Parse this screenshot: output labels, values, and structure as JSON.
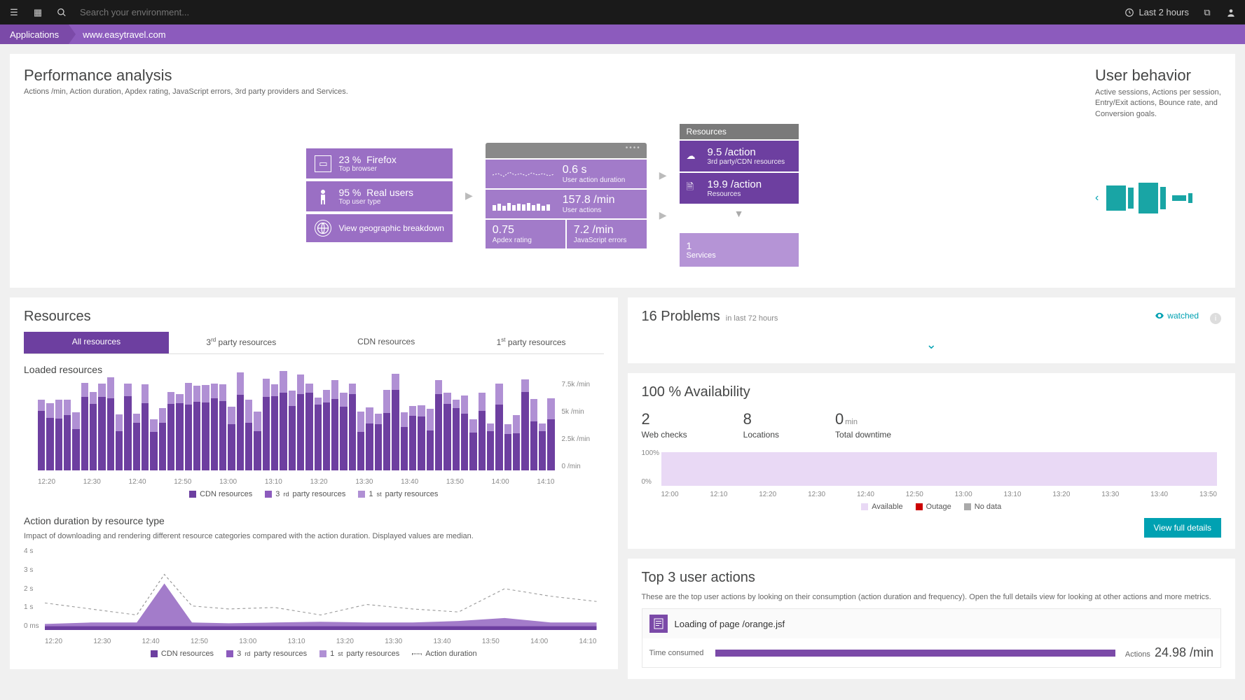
{
  "topbar": {
    "search_placeholder": "Search your environment...",
    "timerange": "Last 2 hours"
  },
  "breadcrumb": {
    "item1": "Applications",
    "item2": "www.easytravel.com"
  },
  "perf": {
    "title": "Performance analysis",
    "subtitle": "Actions /min, Action duration, Apdex rating, JavaScript errors, 3rd party providers and Services.",
    "browser_pct": "23 %",
    "browser_name": "Firefox",
    "browser_sub": "Top browser",
    "users_pct": "95 %",
    "users_name": "Real users",
    "users_sub": "Top user type",
    "geo": "View geographic breakdown",
    "duration": "0.6 s",
    "duration_sub": "User action duration",
    "actions_min": "157.8 /min",
    "actions_sub": "User actions",
    "apdex": "0.75",
    "apdex_sub": "Apdex rating",
    "jserr": "7.2 /min",
    "jserr_sub": "JavaScript errors",
    "resources_head": "Resources",
    "res1": "9.5 /action",
    "res1_sub": "3rd party/CDN resources",
    "res2": "19.9 /action",
    "res2_sub": "Resources",
    "svc_n": "1",
    "svc_sub": "Services"
  },
  "userbeh": {
    "title": "User behavior",
    "subtitle": "Active sessions, Actions per session, Entry/Exit actions, Bounce rate, and Conversion goals."
  },
  "resources": {
    "title": "Resources",
    "tabs": {
      "all": "All resources",
      "third": "3rd party resources",
      "cdn": "CDN resources",
      "first": "1st party resources"
    },
    "loaded": "Loaded resources",
    "legend_cdn": "CDN resources",
    "legend_third": "3rd party resources",
    "legend_first": "1st party resources",
    "action_title": "Action duration by resource type",
    "action_desc": "Impact of downloading and rendering different resource categories compared with the action duration. Displayed values are median.",
    "legend_action": "Action duration"
  },
  "problems": {
    "title": "16 Problems",
    "in": "in last 72 hours",
    "watched": "watched"
  },
  "avail": {
    "title": "100 % Availability",
    "webchecks_n": "2",
    "webchecks_l": "Web checks",
    "locations_n": "8",
    "locations_l": "Locations",
    "downtime_n": "0",
    "downtime_u": "min",
    "downtime_l": "Total downtime",
    "leg_available": "Available",
    "leg_outage": "Outage",
    "leg_nodata": "No data",
    "btn": "View full details"
  },
  "topactions": {
    "title": "Top 3 user actions",
    "desc": "These are the top user actions by looking on their consumption (action duration and frequency). Open the full details view for looking at other actions and more metrics.",
    "a1_name": "Loading of page /orange.jsf",
    "a1_time_lbl": "Time consumed",
    "a1_actions_lbl": "Actions",
    "a1_actions_v": "24.98 /min"
  },
  "chart_data": [
    {
      "type": "bar",
      "title": "Loaded resources",
      "ylabel": "/min",
      "ylim": [
        0,
        7500
      ],
      "categories": [
        "12:20",
        "12:30",
        "12:40",
        "12:50",
        "13:00",
        "13:10",
        "13:20",
        "13:30",
        "13:40",
        "13:50",
        "14:00",
        "14:10"
      ],
      "series": [
        {
          "name": "CDN resources",
          "color": "#6d3fa0"
        },
        {
          "name": "3rd party resources",
          "color": "#8c5bbd"
        },
        {
          "name": "1st party resources",
          "color": "#b090d4"
        }
      ],
      "approx_totals_per_label_kmin": [
        4.2,
        4.5,
        4.0,
        5.8,
        4.3,
        4.6,
        5.2,
        5.0,
        4.4,
        5.3,
        4.1,
        3.8
      ]
    },
    {
      "type": "line",
      "title": "Action duration by resource type",
      "ylabel": "s",
      "ylim": [
        0,
        4
      ],
      "x": [
        "12:20",
        "12:30",
        "12:40",
        "12:50",
        "13:00",
        "13:10",
        "13:20",
        "13:30",
        "13:40",
        "13:50",
        "14:00",
        "14:10"
      ],
      "series": [
        {
          "name": "Action duration",
          "style": "dotted",
          "color": "#888",
          "values": [
            1.3,
            1.0,
            2.7,
            1.2,
            1.0,
            1.1,
            0.7,
            1.3,
            1.0,
            0.9,
            2.0,
            1.4
          ]
        },
        {
          "name": "CDN resources",
          "color": "#6d3fa0",
          "values": [
            0.3,
            0.3,
            0.3,
            0.3,
            0.3,
            0.3,
            0.3,
            0.3,
            0.3,
            0.3,
            0.3,
            0.3
          ]
        },
        {
          "name": "3rd party resources",
          "color": "#8c5bbd",
          "values": [
            0.4,
            0.4,
            2.3,
            0.4,
            0.4,
            0.4,
            0.4,
            0.5,
            0.4,
            0.4,
            0.5,
            0.4
          ]
        },
        {
          "name": "1st party resources",
          "color": "#b090d4",
          "values": [
            0.3,
            0.3,
            0.3,
            0.3,
            0.3,
            0.3,
            0.3,
            0.3,
            0.3,
            0.3,
            0.3,
            0.3
          ]
        }
      ]
    },
    {
      "type": "area",
      "title": "Availability",
      "ylabel": "%",
      "ylim": [
        0,
        100
      ],
      "x": [
        "12:00",
        "12:10",
        "12:20",
        "12:30",
        "12:40",
        "12:50",
        "13:00",
        "13:10",
        "13:20",
        "13:30",
        "13:40",
        "13:50"
      ],
      "series": [
        {
          "name": "Available",
          "color": "#e9d9f5",
          "values": [
            100,
            100,
            100,
            100,
            100,
            100,
            100,
            100,
            100,
            100,
            100,
            100
          ]
        }
      ]
    }
  ],
  "axes": {
    "loaded_y": [
      "7.5k /min",
      "5k /min",
      "2.5k /min",
      "0 /min"
    ],
    "loaded_x": [
      "12:20",
      "12:30",
      "12:40",
      "12:50",
      "13:00",
      "13:10",
      "13:20",
      "13:30",
      "13:40",
      "13:50",
      "14:00",
      "14:10"
    ],
    "action_y": [
      "4 s",
      "3 s",
      "2 s",
      "1 s",
      "0 ms"
    ],
    "action_x": [
      "12:20",
      "12:30",
      "12:40",
      "12:50",
      "13:00",
      "13:10",
      "13:20",
      "13:30",
      "13:40",
      "13:50",
      "14:00",
      "14:10"
    ],
    "avail_y": [
      "100%",
      "0%"
    ],
    "avail_x": [
      "12:00",
      "12:10",
      "12:20",
      "12:30",
      "12:40",
      "12:50",
      "13:00",
      "13:10",
      "13:20",
      "13:30",
      "13:40",
      "13:50"
    ]
  }
}
